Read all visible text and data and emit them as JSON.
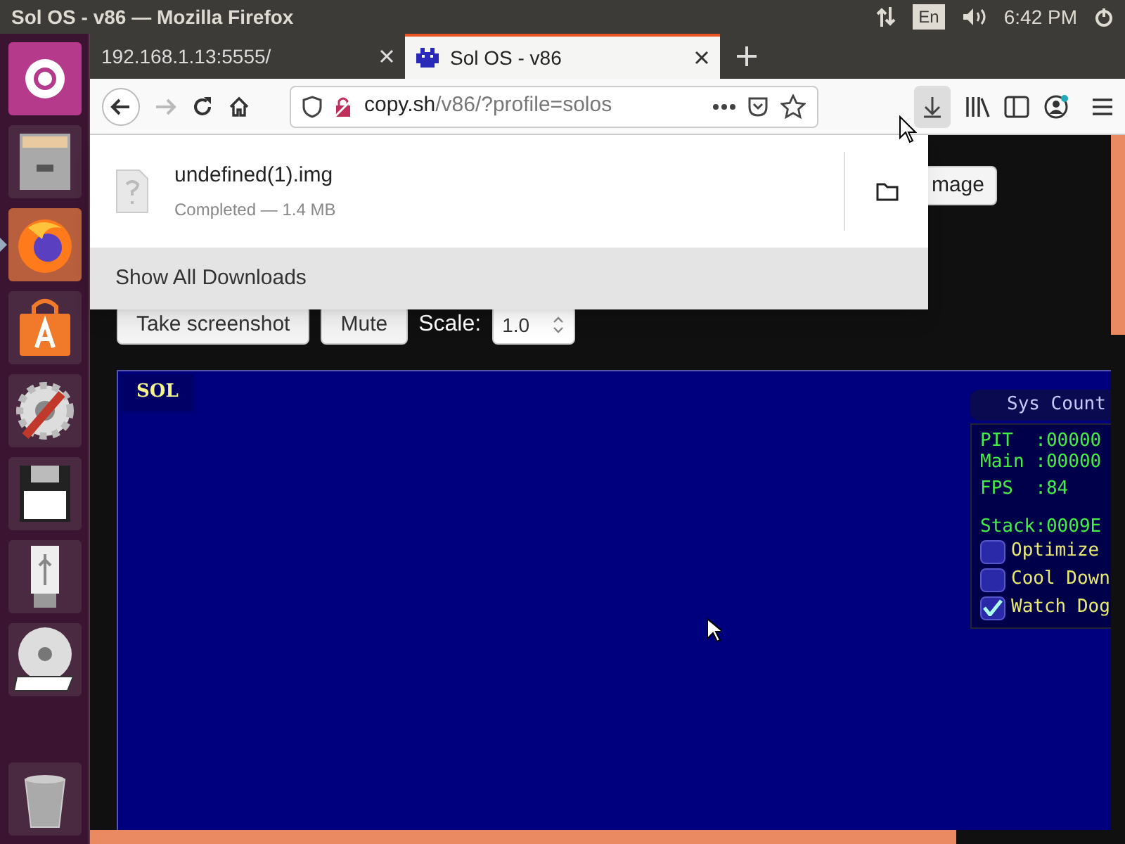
{
  "top_bar": {
    "title": "Sol OS - v86 — Mozilla Firefox",
    "keyboard": "En",
    "time": "6:42 PM"
  },
  "launcher": [
    {
      "kind": "ubuntu",
      "running": false
    },
    {
      "kind": "files",
      "running": false
    },
    {
      "kind": "firefox",
      "running": true
    },
    {
      "kind": "store",
      "running": false
    },
    {
      "kind": "settings",
      "running": false
    },
    {
      "kind": "floppy",
      "running": false
    },
    {
      "kind": "usb",
      "running": false
    },
    {
      "kind": "dvd",
      "running": false
    },
    {
      "kind": "trash",
      "running": false
    }
  ],
  "tabs": [
    {
      "label": "192.168.1.13:5555/",
      "selected": false
    },
    {
      "label": "Sol OS - v86",
      "selected": true
    }
  ],
  "address": {
    "host": "copy.sh",
    "path": "/v86/?profile=solos"
  },
  "downloads": {
    "items": [
      {
        "name": "undefined(1).img",
        "status": "Completed — 1.4 MB"
      }
    ],
    "footer": "Show All Downloads"
  },
  "page": {
    "image_button": "mage",
    "buttons": [
      "Take screenshot",
      "Mute"
    ],
    "scale_label": "Scale:",
    "scale_value": "1.0"
  },
  "emulator": {
    "tab": "SOL",
    "counter": {
      "title": "Sys Count",
      "lines": [
        "PIT  :00000",
        "Main :00000",
        "FPS  :84",
        "Stack:0009E"
      ],
      "options": [
        {
          "label": "Optimize",
          "checked": false
        },
        {
          "label": "Cool Down",
          "checked": false
        },
        {
          "label": "Watch Dog",
          "checked": true
        }
      ]
    }
  }
}
